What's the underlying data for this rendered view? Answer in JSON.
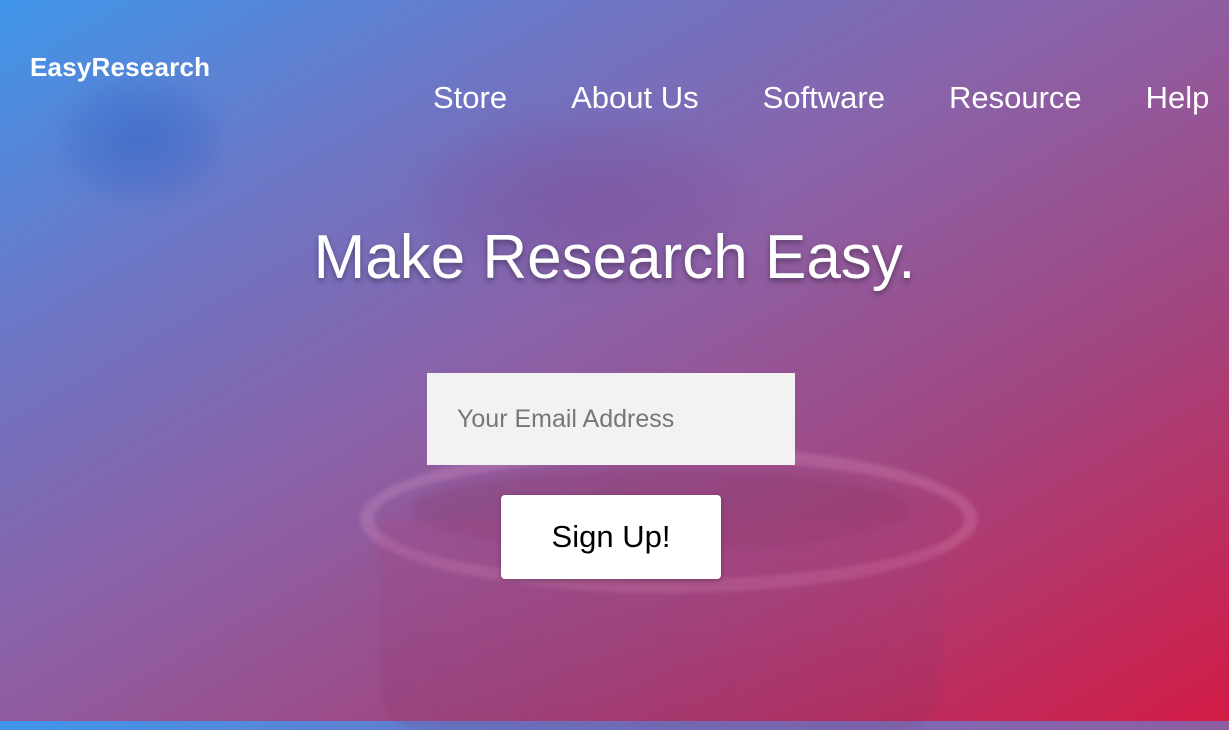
{
  "brand": {
    "name": "EasyResearch"
  },
  "nav": {
    "items": [
      "Store",
      "About Us",
      "Software",
      "Resource",
      "Help"
    ]
  },
  "hero": {
    "headline": "Make Research Easy."
  },
  "signup": {
    "email_placeholder": "Your Email Address",
    "button_label": "Sign Up!"
  },
  "colors": {
    "gradient_start": "#3f96ea",
    "gradient_mid": "#8a62a8",
    "gradient_end": "#d21b45",
    "input_bg": "#f2f2f2",
    "button_bg": "#ffffff"
  }
}
